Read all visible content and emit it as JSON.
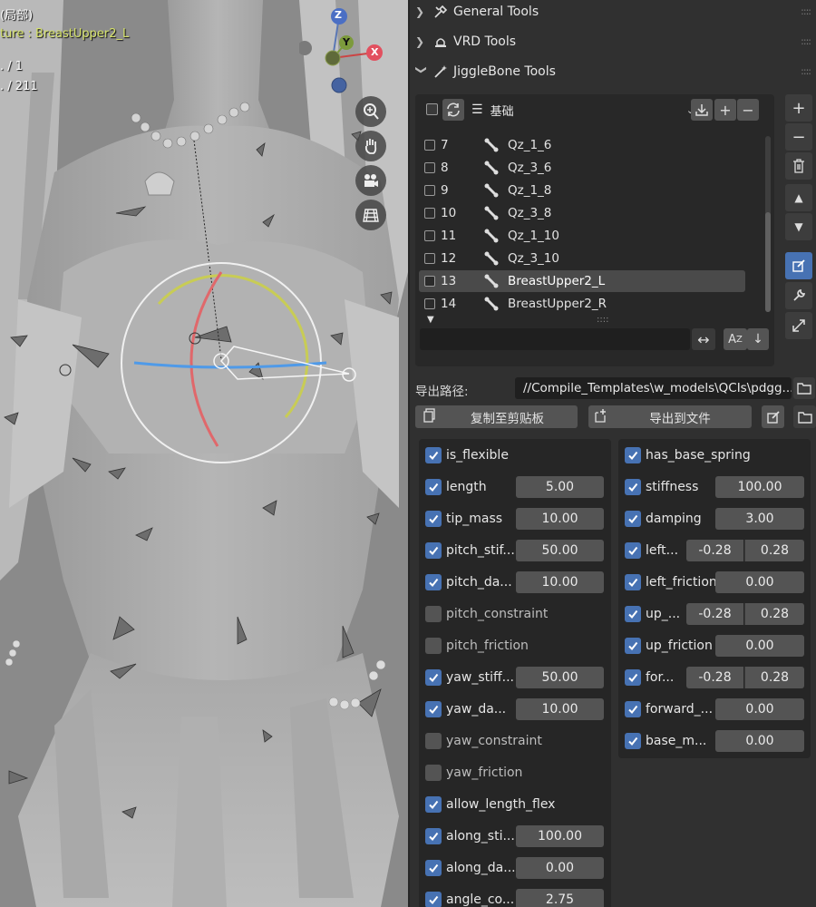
{
  "viewport": {
    "header_lines": [
      "(局部)",
      "ture : BreastUpper2_L",
      ". / 1",
      ". / 211"
    ],
    "gizmo_axes": [
      "Z",
      "Y",
      "X"
    ],
    "nav_icons": [
      "zoom-icon",
      "hand-pan-icon",
      "camera-icon",
      "grid-icon"
    ]
  },
  "sections": {
    "general_tools": "General Tools",
    "vrd_tools": "VRD Tools",
    "jigglebone_tools": "JiggleBone Tools"
  },
  "list": {
    "dropdown_label": "基础",
    "rows": [
      {
        "num": "7",
        "name": "Qz_1_6"
      },
      {
        "num": "8",
        "name": "Qz_3_6"
      },
      {
        "num": "9",
        "name": "Qz_1_8"
      },
      {
        "num": "10",
        "name": "Qz_3_8"
      },
      {
        "num": "11",
        "name": "Qz_1_10"
      },
      {
        "num": "12",
        "name": "Qz_3_10"
      },
      {
        "num": "13",
        "name": "BreastUpper2_L"
      },
      {
        "num": "14",
        "name": "BreastUpper2_R"
      }
    ],
    "selected_index": 6,
    "filter_value": ""
  },
  "export": {
    "path_label": "导出路径:",
    "path_value": "//Compile_Templates\\w_models\\QCIs\\pdgg....",
    "copy_button": "复制至剪贴板",
    "export_button": "导出到文件"
  },
  "left_props": [
    {
      "name": "is_flexible",
      "checked": true,
      "value": ""
    },
    {
      "name": "length",
      "checked": true,
      "value": "5.00"
    },
    {
      "name": "tip_mass",
      "checked": true,
      "value": "10.00"
    },
    {
      "name": "pitch_stif...",
      "checked": true,
      "value": "50.00"
    },
    {
      "name": "pitch_da...",
      "checked": true,
      "value": "10.00"
    },
    {
      "name": "pitch_constraint",
      "checked": false,
      "value": ""
    },
    {
      "name": "pitch_friction",
      "checked": false,
      "value": ""
    },
    {
      "name": "yaw_stiff...",
      "checked": true,
      "value": "50.00"
    },
    {
      "name": "yaw_da...",
      "checked": true,
      "value": "10.00"
    },
    {
      "name": "yaw_constraint",
      "checked": false,
      "value": ""
    },
    {
      "name": "yaw_friction",
      "checked": false,
      "value": ""
    },
    {
      "name": "allow_length_flex",
      "checked": true,
      "value": ""
    },
    {
      "name": "along_sti...",
      "checked": true,
      "value": "100.00"
    },
    {
      "name": "along_da...",
      "checked": true,
      "value": "0.00"
    },
    {
      "name": "angle_co...",
      "checked": true,
      "value": "2.75"
    }
  ],
  "right_props": [
    {
      "name": "has_base_spring",
      "checked": true,
      "value": "",
      "value2": ""
    },
    {
      "name": "stiffness",
      "checked": true,
      "value": "100.00",
      "value2": ""
    },
    {
      "name": "damping",
      "checked": true,
      "value": "3.00",
      "value2": ""
    },
    {
      "name": "left...",
      "checked": true,
      "value": "-0.28",
      "value2": "0.28"
    },
    {
      "name": "left_friction",
      "checked": true,
      "value": "0.00",
      "value2": ""
    },
    {
      "name": "up_...",
      "checked": true,
      "value": "-0.28",
      "value2": "0.28"
    },
    {
      "name": "up_friction",
      "checked": true,
      "value": "0.00",
      "value2": ""
    },
    {
      "name": "for...",
      "checked": true,
      "value": "-0.28",
      "value2": "0.28"
    },
    {
      "name": "forward_...",
      "checked": true,
      "value": "0.00",
      "value2": ""
    },
    {
      "name": "base_m...",
      "checked": true,
      "value": "0.00",
      "value2": ""
    }
  ],
  "colors": {
    "accent": "#4772b3",
    "panel": "#303030",
    "field": "#545454",
    "bone_text": "#d6e26b"
  }
}
